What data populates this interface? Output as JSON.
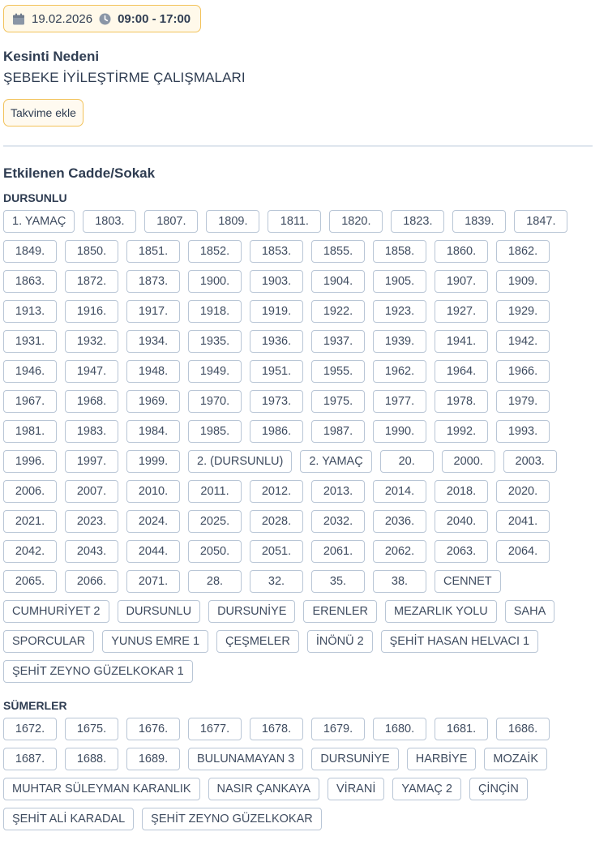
{
  "outage": {
    "date": "19.02.2026",
    "time": "09:00 - 17:00",
    "date_icon": "calendar-icon",
    "time_icon": "clock-icon",
    "accent_color": "#f2c25a"
  },
  "reason": {
    "label": "Kesinti Nedeni",
    "value": "ŞEBEKE İYİLEŞTİRME ÇALIŞMALARI"
  },
  "calendar_button": {
    "label": "Takvime ekle"
  },
  "affected": {
    "label": "Etkilenen Cadde/Sokak",
    "groups": [
      {
        "name": "DURSUNLU",
        "streets": [
          "1. YAMAÇ",
          "1803.",
          "1807.",
          "1809.",
          "1811.",
          "1820.",
          "1823.",
          "1839.",
          "1847.",
          "1849.",
          "1850.",
          "1851.",
          "1852.",
          "1853.",
          "1855.",
          "1858.",
          "1860.",
          "1862.",
          "1863.",
          "1872.",
          "1873.",
          "1900.",
          "1903.",
          "1904.",
          "1905.",
          "1907.",
          "1909.",
          "1913.",
          "1916.",
          "1917.",
          "1918.",
          "1919.",
          "1922.",
          "1923.",
          "1927.",
          "1929.",
          "1931.",
          "1932.",
          "1934.",
          "1935.",
          "1936.",
          "1937.",
          "1939.",
          "1941.",
          "1942.",
          "1946.",
          "1947.",
          "1948.",
          "1949.",
          "1951.",
          "1955.",
          "1962.",
          "1964.",
          "1966.",
          "1967.",
          "1968.",
          "1969.",
          "1970.",
          "1973.",
          "1975.",
          "1977.",
          "1978.",
          "1979.",
          "1981.",
          "1983.",
          "1984.",
          "1985.",
          "1986.",
          "1987.",
          "1990.",
          "1992.",
          "1993.",
          "1996.",
          "1997.",
          "1999.",
          "2. (DURSUNLU)",
          "2. YAMAÇ",
          "20.",
          "2000.",
          "2003.",
          "2006.",
          "2007.",
          "2010.",
          "2011.",
          "2012.",
          "2013.",
          "2014.",
          "2018.",
          "2020.",
          "2021.",
          "2023.",
          "2024.",
          "2025.",
          "2028.",
          "2032.",
          "2036.",
          "2040.",
          "2041.",
          "2042.",
          "2043.",
          "2044.",
          "2050.",
          "2051.",
          "2061.",
          "2062.",
          "2063.",
          "2064.",
          "2065.",
          "2066.",
          "2071.",
          "28.",
          "32.",
          "35.",
          "38.",
          "CENNET",
          "CUMHURİYET 2",
          "DURSUNLU",
          "DURSUNİYE",
          "ERENLER",
          "MEZARLIK YOLU",
          "SAHA",
          "SPORCULAR",
          "YUNUS EMRE 1",
          "ÇEŞMELER",
          "İNÖNÜ 2",
          "ŞEHİT HASAN HELVACI 1",
          "ŞEHİT ZEYNO GÜZELKOKAR 1"
        ]
      },
      {
        "name": "SÜMERLER",
        "streets": [
          "1672.",
          "1675.",
          "1676.",
          "1677.",
          "1678.",
          "1679.",
          "1680.",
          "1681.",
          "1686.",
          "1687.",
          "1688.",
          "1689.",
          "BULUNAMAYAN 3",
          "DURSUNİYE",
          "HARBİYE",
          "MOZAİK",
          "MUHTAR SÜLEYMAN KARANLIK",
          "NASIR ÇANKAYA",
          "VİRANİ",
          "YAMAÇ 2",
          "ÇİNÇİN",
          "ŞEHİT ALİ KARADAL",
          "ŞEHİT ZEYNO GÜZELKOKAR"
        ]
      }
    ]
  }
}
